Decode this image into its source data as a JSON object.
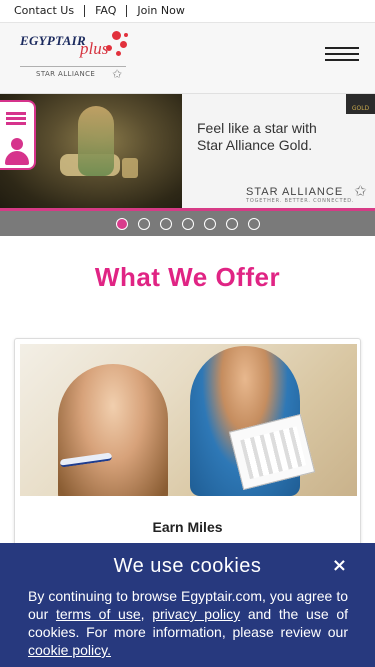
{
  "topbar": {
    "links": [
      "Contact Us",
      "FAQ",
      "Join Now"
    ]
  },
  "header": {
    "logo_brand": "EGYPTAIR",
    "logo_plus": "plus",
    "logo_alliance": "STAR ALLIANCE"
  },
  "banner": {
    "tagline_line1": "Feel like a star with",
    "tagline_line2": "Star Alliance Gold.",
    "alliance_name": "STAR ALLIANCE",
    "alliance_sub": "TOGETHER. BETTER. CONNECTED.",
    "gold_badge": "GOLD",
    "slides": 7,
    "active_slide": 1
  },
  "offer": {
    "title": "What We Offer",
    "card_title": "Earn Miles"
  },
  "cookie": {
    "title": "We use cookies",
    "close": "×",
    "text_part1": "By continuing to browse Egyptair.com, you agree to our",
    "terms_link": "terms of use",
    "text_part2": ",",
    "privacy_link": "privacy policy",
    "text_part3": "and the use of cookies. For more information, please review our",
    "cookie_link": "cookie policy."
  },
  "colors": {
    "accent_pink": "#e02484",
    "cookie_bg": "#27397e",
    "brand_red": "#e2313c"
  }
}
